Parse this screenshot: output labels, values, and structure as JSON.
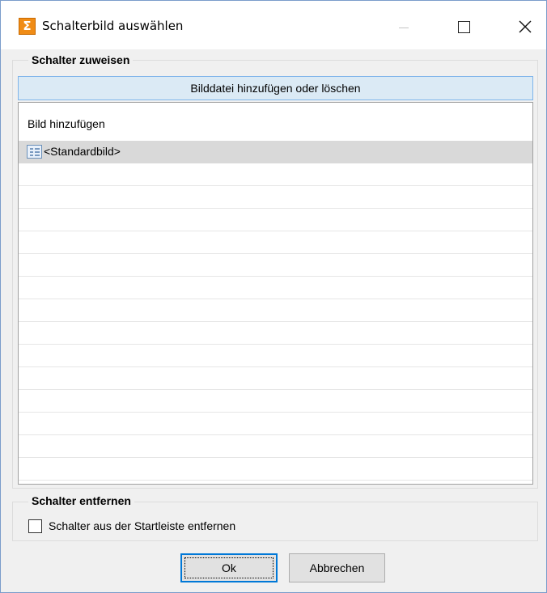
{
  "window": {
    "title": "Schalterbild auswählen",
    "app_icon_glyph": "Σ",
    "accent_color": "#f08c16"
  },
  "assign_group": {
    "label": "Schalter zuweisen",
    "add_file_button": "Bilddatei hinzufügen oder löschen",
    "list_header": "Bild hinzufügen",
    "items": [
      {
        "label": "<Standardbild>",
        "selected": true,
        "icon": "image-list-icon"
      }
    ]
  },
  "remove_group": {
    "label": "Schalter entfernen",
    "checkbox_label": "Schalter aus der Startleiste entfernen",
    "checked": false
  },
  "buttons": {
    "ok": "Ok",
    "cancel": "Abbrechen"
  }
}
